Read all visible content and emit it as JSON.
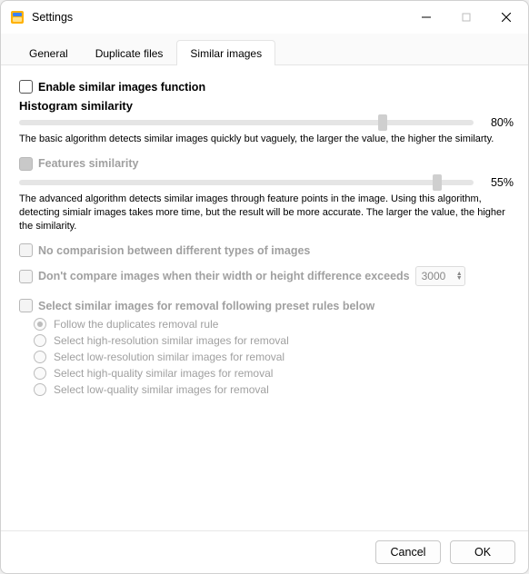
{
  "window": {
    "title": "Settings"
  },
  "tabs": {
    "general": "General",
    "duplicate": "Duplicate files",
    "similar": "Similar images"
  },
  "enable": {
    "label": "Enable similar images function",
    "checked": false
  },
  "histogram": {
    "heading": "Histogram similarity",
    "value": 80,
    "value_label": "80%",
    "desc": "The basic algorithm detects similar images quickly but vaguely, the larger the value, the higher the similarty."
  },
  "features": {
    "heading": "Features similarity",
    "checked": true,
    "value": 55,
    "value_label": "55%",
    "desc": "The advanced algorithm detects similar images through feature points in the image. Using this algorithm, detecting simialr images takes more time, but the result will be more accurate. The larger the value, the higher the similarity."
  },
  "no_compare_types": {
    "label": "No comparision between different types of images",
    "checked": false
  },
  "size_diff": {
    "label": "Don't compare images when their width or height difference exceeds",
    "value": "3000",
    "checked": false
  },
  "preset": {
    "label": "Select similar images for removal following preset rules below",
    "checked": false,
    "options": {
      "follow": "Follow the duplicates removal rule",
      "high_res": "Select high-resolution similar images for removal",
      "low_res": "Select low-resolution similar images for removal",
      "high_q": "Select high-quality similar images for removal",
      "low_q": "Select low-quality similar images for removal"
    },
    "selected": "follow"
  },
  "buttons": {
    "cancel": "Cancel",
    "ok": "OK"
  }
}
